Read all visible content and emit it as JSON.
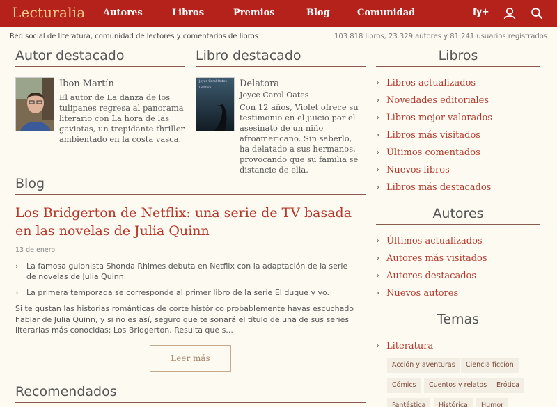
{
  "brand": {
    "logo": "Lecturalia"
  },
  "nav": {
    "autores": "Autores",
    "libros": "Libros",
    "premios": "Premios",
    "blog": "Blog",
    "comunidad": "Comunidad",
    "social": "f𝐲+"
  },
  "subbar": {
    "tagline": "Red social de literatura, comunidad de lectores y comentarios de libros",
    "stats": "103.818 libros, 23.329 autores y 81.241 usuarios registrados"
  },
  "autor_destacado": {
    "heading": "Autor destacado",
    "name": "Ibon Martín",
    "blurb": "El autor de La danza de los tulipanes regresa al panorama literario con La hora de las gaviotas, un trepidante thriller ambientado en la costa vasca."
  },
  "libro_destacado": {
    "heading": "Libro destacado",
    "title": "Delatora",
    "author": "Joyce Carol Oates",
    "cover_author": "Joyce Carol Oates",
    "cover_title": "Delatora",
    "blurb": "Con 12 años, Violet ofrece su testimonio en el juicio por el asesinato de un niño afroamericano. Sin saberlo, ha delatado a sus hermanos, provocando que su familia se distancie de ella."
  },
  "blog": {
    "heading": "Blog",
    "title": "Los Bridgerton de Netflix: una serie de TV basada en las novelas de Julia Quinn",
    "date": "13 de enero",
    "bullets": [
      "La famosa guionista Shonda Rhimes debuta en Netflix con la adaptación de la serie de novelas de Julia Quinn.",
      "La primera temporada se corresponde al primer libro de la serie El duque y yo."
    ],
    "body": "Si te gustan las historias románticas de corte histórico probablemente hayas escuchado hablar de Julia Quinn, y si no es así, seguro que te sonará el título de una de sus series literarias más conocidas: Los Bridgerton. Resulta que s...",
    "more": "Leer más"
  },
  "recomendados": {
    "heading": "Recomendados"
  },
  "libros": {
    "heading": "Libros",
    "items": [
      "Libros actualizados",
      "Novedades editoriales",
      "Libros mejor valorados",
      "Libros más visitados",
      "Últimos comentados",
      "Nuevos libros",
      "Libros más destacados"
    ]
  },
  "autores": {
    "heading": "Autores",
    "items": [
      "Últimos actualizados",
      "Autores más visitados",
      "Autores destacados",
      "Nuevos autores"
    ]
  },
  "temas": {
    "heading": "Temas",
    "items": [
      "Literatura"
    ],
    "tags": [
      "Acción y aventuras",
      "Ciencia ficción",
      "Cómics",
      "Cuentos y relatos",
      "Erótica",
      "Fantástica",
      "Histórica",
      "Humor"
    ]
  },
  "colors": {
    "brand": "#b5221b",
    "link": "#b5382a",
    "background": "#fdfaf2"
  },
  "icons": {
    "user": "user-icon",
    "search": "search-icon",
    "chevron": "chevron-right-icon"
  }
}
